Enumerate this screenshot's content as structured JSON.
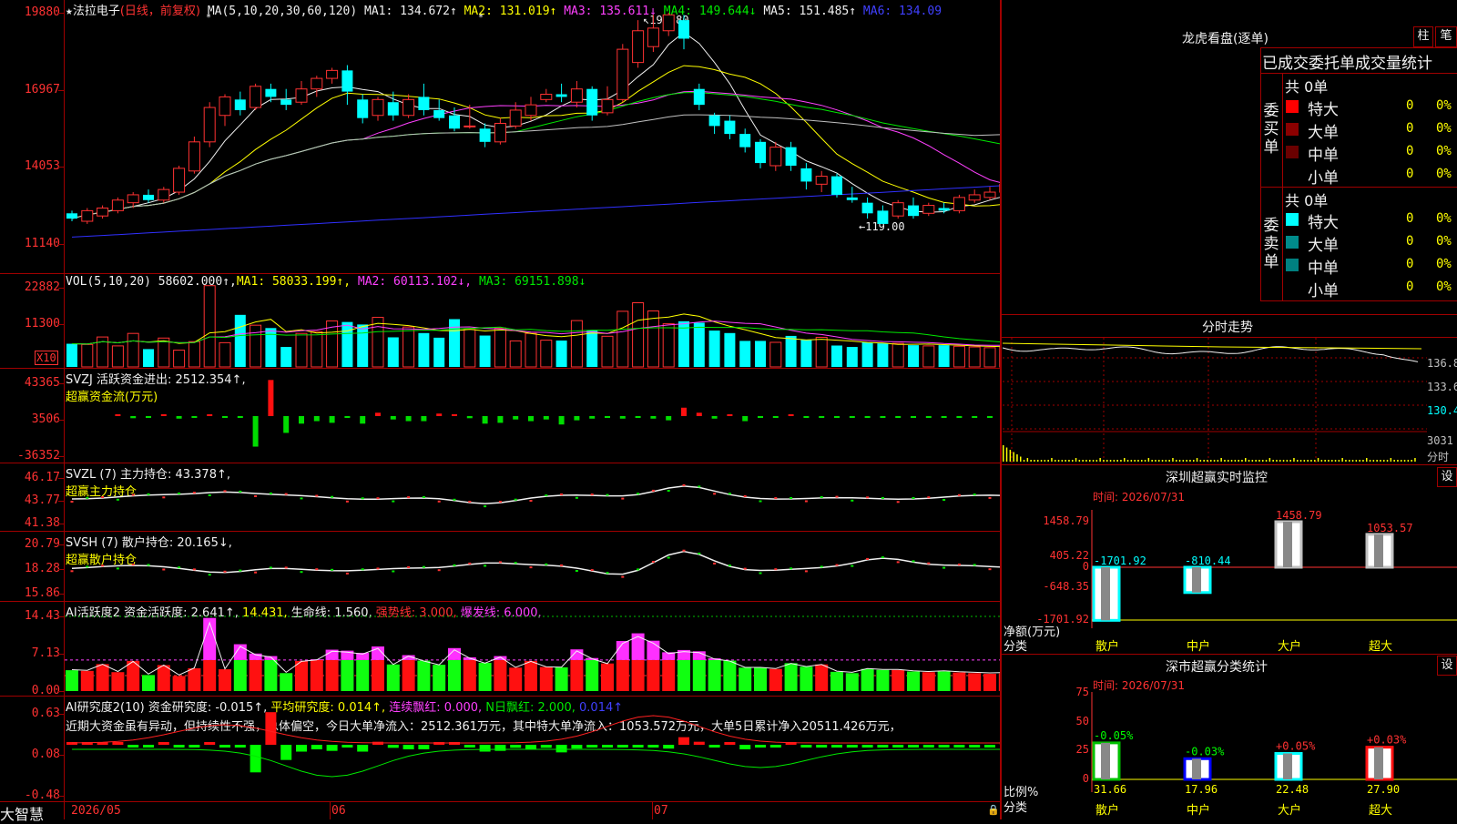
{
  "stock": {
    "star": "★",
    "name": "法拉电子",
    "period": "(日线，前复权)"
  },
  "ma_header": {
    "label": "MA(5,10,20,30,60,120)",
    "items": [
      {
        "text": "MA1: 134.672↑",
        "color": "#f0f0f0"
      },
      {
        "text": "MA2: 131.019↑",
        "color": "#ffff00"
      },
      {
        "text": "MA3: 135.611↓",
        "color": "#ff40ff"
      },
      {
        "text": "MA4: 149.644↓",
        "color": "#00e800"
      },
      {
        "text": "MA5: 151.485↑",
        "color": "#f0f0f0"
      },
      {
        "text": "MA6: 134.09",
        "color": "#4040ff"
      }
    ]
  },
  "price_axis": [
    "19880",
    "16967",
    "14053",
    "11140"
  ],
  "price_high_mark": "198.80",
  "price_low_mark": "119.00",
  "vol_header": {
    "label": "VOL(5,10,20)",
    "value": "58602.000↑,",
    "items": [
      {
        "text": "MA1: 58033.199↑,",
        "color": "#ffff00"
      },
      {
        "text": "MA2: 60113.102↓,",
        "color": "#ff40ff"
      },
      {
        "text": "MA3: 69151.898↓",
        "color": "#00e800"
      }
    ]
  },
  "vol_axis": [
    "22882",
    "11300"
  ],
  "vol_unit": "X10",
  "svzj": {
    "line1": "SVZJ  活跃资金进出: 2512.354↑,",
    "line2": "超赢资金流(万元)",
    "axis": [
      "43365",
      "3506",
      "-36352"
    ]
  },
  "svzl": {
    "line1": "SVZL (7) 主力持仓: 43.378↑,",
    "line2": "超赢主力持仓",
    "axis": [
      "46.17",
      "43.77",
      "41.38"
    ]
  },
  "svsh": {
    "line1": "SVSH (7) 散户持仓: 20.165↓,",
    "line2": "超赢散户持仓",
    "axis": [
      "20.79",
      "18.28",
      "15.86"
    ]
  },
  "ai1": {
    "items": [
      {
        "text": "AI活跃度2 资金活跃度: 2.641↑,",
        "color": "#f0f0f0"
      },
      {
        "text": "14.431,",
        "color": "#ffff00"
      },
      {
        "text": "生命线: 1.560,",
        "color": "#f0f0f0"
      },
      {
        "text": "强势线: 3.000,",
        "color": "#ff3232"
      },
      {
        "text": "爆发线: 6.000,",
        "color": "#ff40ff"
      }
    ],
    "axis": [
      "14.43",
      "7.13",
      "0.00"
    ]
  },
  "ai2": {
    "items": [
      {
        "text": "AI研究度2(10) 资金研究度: -0.015↑,",
        "color": "#f0f0f0"
      },
      {
        "text": "平均研究度: 0.014↑,",
        "color": "#ffff00"
      },
      {
        "text": "连续飘红: 0.000,",
        "color": "#ff40ff"
      },
      {
        "text": "N日飘红: 2.000,",
        "color": "#00e800"
      },
      {
        "text": "0.014↑",
        "color": "#4040ff"
      }
    ],
    "comment": "近期大资金虽有异动，但持续性不强，总体偏空，今日大单净流入：2512.361万元，其中特大单净流入：1053.572万元，大单5日累计净入20511.426万元，",
    "axis": [
      "0.63",
      "0.08",
      "-0.48"
    ]
  },
  "date_axis": [
    "2026/05",
    "06",
    "07"
  ],
  "brand": "大智慧",
  "right_panel": {
    "title": "龙虎看盘(逐单)",
    "btn1": "柱",
    "btn2": "笔",
    "subtitle": "已成交委托单成交量统计",
    "buy_label": "委买单",
    "sell_label": "委卖单",
    "buy_total": "共 0单",
    "sell_total": "共 0单",
    "rows": [
      {
        "name": "特大",
        "count": "0",
        "pct": "0%"
      },
      {
        "name": "大单",
        "count": "0",
        "pct": "0%"
      },
      {
        "name": "中单",
        "count": "0",
        "pct": "0%"
      },
      {
        "name": "小单",
        "count": "0",
        "pct": "0%"
      }
    ],
    "buy_colors": [
      "#ff0000",
      "#8b0000",
      "#6a0000",
      ""
    ],
    "sell_colors": [
      "#00ffff",
      "#008b8b",
      "#008080",
      ""
    ],
    "intraday_title": "分时走势",
    "intraday_axis": [
      "136.8",
      "133.6",
      "130.4"
    ],
    "intraday_vol": "3031",
    "intraday_unit": "分时",
    "monitor_title": "深圳超赢实时监控",
    "monitor_btn": "设",
    "monitor_time": "时间: 2026/07/31",
    "monitor_axis": [
      "1458.79",
      "405.22",
      "0",
      "-648.35",
      "-1701.92"
    ],
    "monitor_ylabel": "净额(万元)",
    "monitor_xlabel": "分类",
    "monitor_values": [
      "-1701.92",
      "-810.44",
      "1458.79",
      "1053.57"
    ],
    "categories": [
      "散户",
      "中户",
      "大户",
      "超大"
    ],
    "stats_title": "深市超赢分类统计",
    "stats_btn": "设",
    "stats_time": "时间: 2026/07/31",
    "stats_axis": [
      "75",
      "50",
      "25",
      "0"
    ],
    "stats_ylabel": "比例%",
    "stats_xlabel": "分类",
    "stats_pct": [
      "-0.05%",
      "-0.03%",
      "+0.05%",
      "+0.03%"
    ],
    "stats_values": [
      "31.66",
      "17.96",
      "22.48",
      "27.90"
    ]
  },
  "chart_data": {
    "type": "candlestick",
    "candles": [
      [
        123,
        121,
        124,
        120
      ],
      [
        120,
        124,
        125,
        119
      ],
      [
        122,
        125,
        126,
        121
      ],
      [
        124,
        128,
        129,
        123
      ],
      [
        127,
        130,
        131,
        125
      ],
      [
        130,
        128,
        132,
        127
      ],
      [
        128,
        132,
        133,
        127
      ],
      [
        131,
        140,
        141,
        130
      ],
      [
        139,
        150,
        152,
        138
      ],
      [
        150,
        163,
        165,
        148
      ],
      [
        160,
        167,
        168,
        156
      ],
      [
        166,
        162,
        169,
        160
      ],
      [
        163,
        171,
        172,
        162
      ],
      [
        170,
        167,
        172,
        165
      ],
      [
        166,
        164,
        170,
        162
      ],
      [
        165,
        170,
        173,
        164
      ],
      [
        170,
        174,
        175,
        167
      ],
      [
        174,
        177,
        178,
        172
      ],
      [
        177,
        169,
        179,
        164
      ],
      [
        166,
        159,
        168,
        157
      ],
      [
        160,
        166,
        167,
        158
      ],
      [
        165,
        160,
        169,
        158
      ],
      [
        160,
        166,
        168,
        159
      ],
      [
        167,
        162,
        172,
        160
      ],
      [
        162,
        159,
        166,
        158
      ],
      [
        160,
        155,
        163,
        154
      ],
      [
        156,
        156,
        164,
        155
      ],
      [
        155,
        150,
        157,
        148
      ],
      [
        150,
        157,
        159,
        149
      ],
      [
        156,
        162,
        165,
        155
      ],
      [
        160,
        164,
        167,
        158
      ],
      [
        166,
        168,
        170,
        165
      ],
      [
        168,
        167,
        172,
        165
      ],
      [
        165,
        170,
        173,
        163
      ],
      [
        170,
        160,
        171,
        158
      ],
      [
        161,
        166,
        171,
        160
      ],
      [
        166,
        185,
        187,
        165
      ],
      [
        180,
        192,
        196,
        178
      ],
      [
        186,
        193,
        198,
        184
      ],
      [
        192,
        198,
        198.8,
        190
      ],
      [
        196,
        189,
        198,
        185
      ],
      [
        170,
        164,
        172,
        162
      ],
      [
        160,
        156,
        161,
        153
      ],
      [
        158,
        153,
        160,
        151
      ],
      [
        153,
        148,
        155,
        146
      ],
      [
        150,
        142,
        151,
        140
      ],
      [
        141,
        148,
        150,
        139
      ],
      [
        148,
        141,
        150,
        139
      ],
      [
        140,
        135,
        142,
        132
      ],
      [
        134,
        137,
        139,
        131
      ],
      [
        137,
        130,
        138,
        129
      ],
      [
        129,
        128,
        133,
        127
      ],
      [
        127,
        123,
        129,
        121
      ],
      [
        124,
        119,
        126,
        119
      ],
      [
        122,
        127,
        128,
        121
      ],
      [
        126,
        122,
        129,
        121
      ],
      [
        123,
        126,
        127,
        122
      ],
      [
        125,
        124,
        127,
        123
      ],
      [
        124,
        129,
        130,
        123
      ],
      [
        128,
        130,
        132,
        127
      ],
      [
        129,
        131,
        133,
        128
      ],
      [
        131,
        134,
        135,
        130
      ],
      [
        133,
        136,
        137,
        132
      ]
    ],
    "volumes": [
      6.5,
      6.3,
      8.4,
      5.9,
      9.4,
      5.0,
      8.1,
      4.7,
      7.1,
      22.8,
      6.8,
      14.6,
      11.7,
      10.9,
      5.6,
      9.4,
      9.9,
      12.9,
      12.6,
      11.9,
      13.9,
      8.3,
      11.2,
      9.5,
      8.2,
      13.4,
      10.5,
      8.8,
      10.9,
      7.3,
      9.4,
      7.5,
      7.4,
      13.0,
      10.3,
      8.6,
      15.6,
      18.0,
      15.7,
      12.1,
      12.8,
      12.4,
      10.2,
      9.5,
      7.3,
      7.3,
      6.9,
      8.7,
      7.6,
      8.3,
      6.0,
      5.6,
      6.9,
      6.6,
      6.6,
      6.1,
      5.9,
      6.1,
      5.8,
      5.6,
      5.4,
      5.5,
      5.9
    ],
    "fund_flow": [
      1200,
      -2500,
      -1800,
      2200,
      -3000,
      -1500,
      1800,
      -2200,
      -1000,
      -36352,
      43000,
      -20000,
      -9000,
      -6000,
      -8000,
      -2000,
      -9000,
      4000,
      -4000,
      -6000,
      -6000,
      3000,
      1800,
      -2500,
      -9000,
      -8000,
      -4000,
      -6000,
      -4000,
      -10000,
      -5000,
      -3000,
      -2000,
      -3000,
      -1000,
      -3000,
      -5000,
      10000,
      4000,
      -3000,
      1500,
      -6000,
      -1500,
      -1000,
      2000,
      -1500,
      -1000,
      -1000,
      -1500,
      -1000,
      -1500,
      -1000,
      -1500,
      -1000,
      -1500,
      -1000,
      -1500,
      -1000,
      2512
    ]
  }
}
